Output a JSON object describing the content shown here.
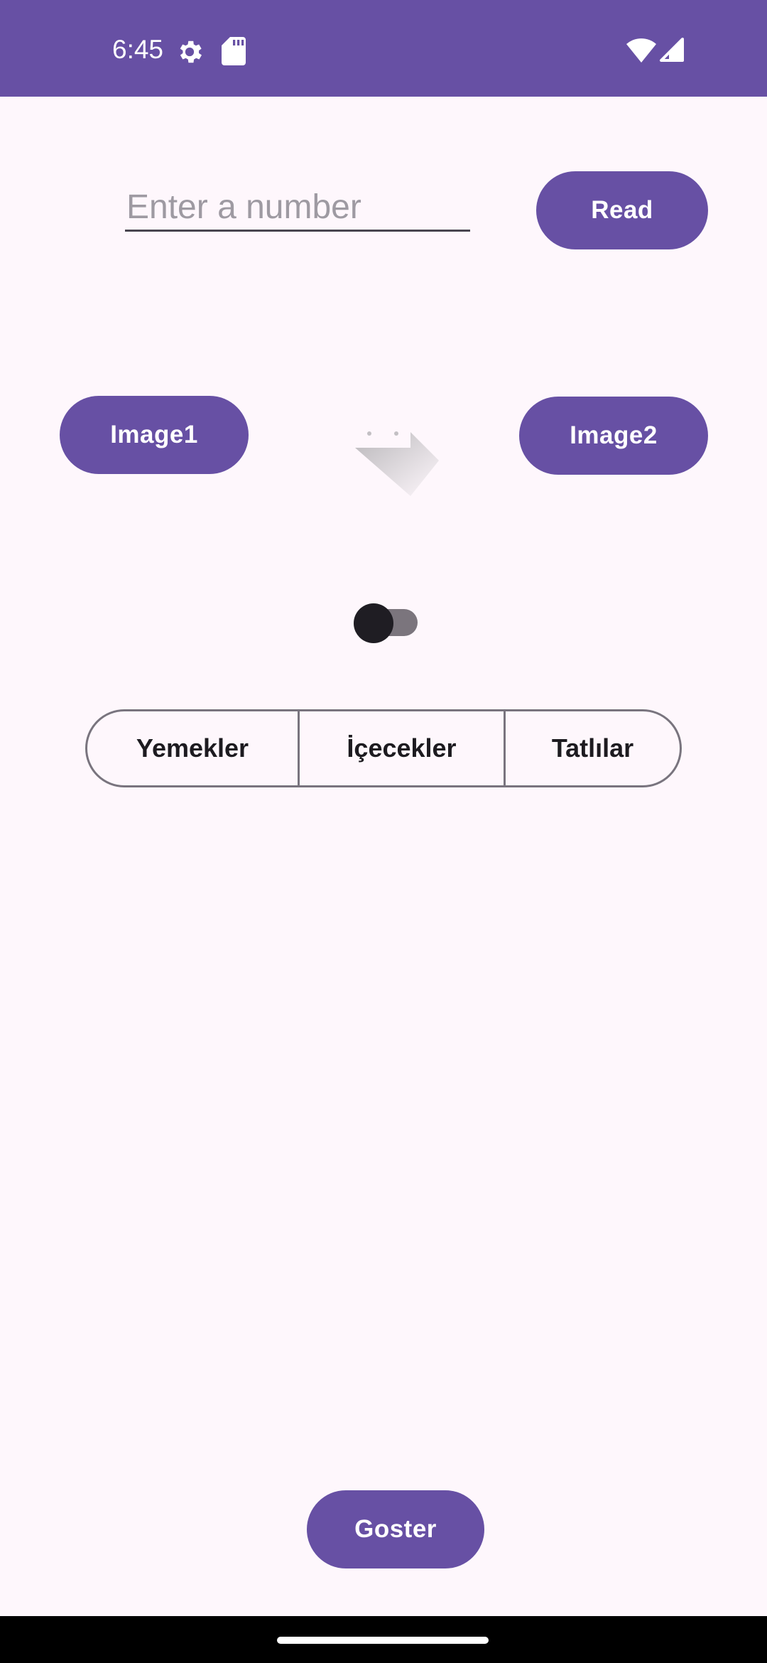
{
  "status_bar": {
    "time": "6:45",
    "icons": [
      "settings-icon",
      "sd-card-icon",
      "wifi-icon",
      "signal-icon"
    ],
    "background": "#6750a4"
  },
  "number_input": {
    "placeholder": "Enter a number",
    "value": ""
  },
  "buttons": {
    "read": "Read",
    "image1": "Image1",
    "image2": "Image2",
    "goster": "Goster"
  },
  "image_view": {
    "icon": "image-placeholder-icon"
  },
  "switch": {
    "checked": false
  },
  "segments": [
    "Yemekler",
    "İçecekler",
    "Tatlılar"
  ],
  "colors": {
    "primary": "#6750a4",
    "background": "#fef7fc",
    "outline": "#79747e"
  }
}
